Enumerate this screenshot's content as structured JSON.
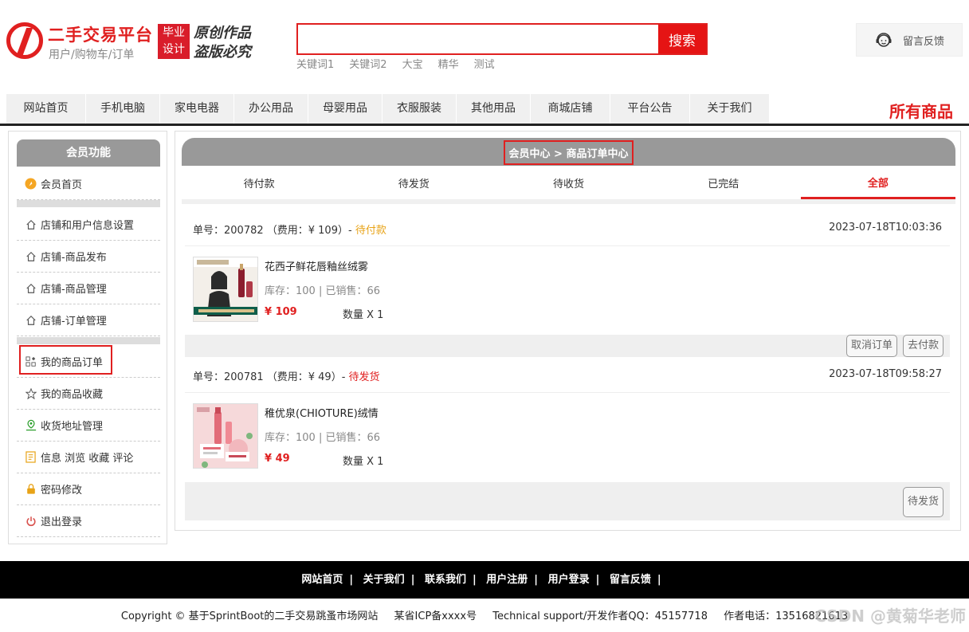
{
  "header": {
    "logo_title": "二手交易平台",
    "logo_sub": "用户/购物车/订单",
    "badge_line1": "毕业",
    "badge_line2": "设计",
    "slogan_line1": "原创作品",
    "slogan_line2": "盗版必究",
    "search_value": "",
    "search_button": "搜索",
    "keywords": [
      "关键词1",
      "关键词2",
      "大宝",
      "精华",
      "测试"
    ],
    "feedback_label": "留言反馈"
  },
  "nav": {
    "items": [
      "网站首页",
      "手机电脑",
      "家电电器",
      "办公用品",
      "母婴用品",
      "衣服服装",
      "其他用品",
      "商城店铺",
      "平台公告",
      "关于我们"
    ],
    "all_goods": "所有商品"
  },
  "sidebar": {
    "title": "会员功能",
    "items": [
      {
        "label": "会员首页",
        "icon": "orange-circle-icon"
      },
      {
        "label": "店铺和用户信息设置",
        "icon": "home-icon"
      },
      {
        "label": "店铺-商品发布",
        "icon": "home-icon"
      },
      {
        "label": "店铺-商品管理",
        "icon": "home-icon"
      },
      {
        "label": "店铺-订单管理",
        "icon": "home-icon"
      },
      {
        "label": "我的商品订单",
        "icon": "grid-icon"
      },
      {
        "label": "我的商品收藏",
        "icon": "star-icon"
      },
      {
        "label": "收货地址管理",
        "icon": "location-icon"
      },
      {
        "label": "信息 浏览 收藏 评论",
        "icon": "document-icon"
      },
      {
        "label": "密码修改",
        "icon": "lock-icon"
      },
      {
        "label": "退出登录",
        "icon": "power-icon"
      }
    ]
  },
  "main": {
    "breadcrumb": "会员中心 > 商品订单中心",
    "tabs": [
      "待付款",
      "待发货",
      "待收货",
      "已完结",
      "全部"
    ],
    "active_tab": "全部",
    "orders": [
      {
        "prefix": "单号：200782 （费用：¥ 109）- ",
        "status": "待付款",
        "status_color": "#e8a317",
        "time": "2023-07-18T10:03:36",
        "product": "花西子鲜花唇釉丝绒雾",
        "stock": "库存：100 | 已销售：66",
        "price": "¥ 109",
        "qty": "数量 X 1",
        "buttons": [
          "取消订单",
          "去付款"
        ]
      },
      {
        "prefix": "单号：200781 （费用：¥ 49）- ",
        "status": "待发货",
        "status_color": "#e02020",
        "time": "2023-07-18T09:58:27",
        "product": "稚优泉(CHIOTURE)绒情",
        "stock": "库存：100 | 已销售：66",
        "price": "¥ 49",
        "qty": "数量 X 1",
        "buttons": [
          "待发货"
        ]
      }
    ]
  },
  "footer": {
    "links": [
      "网站首页",
      "关于我们",
      "联系我们",
      "用户注册",
      "用户登录",
      "留言反馈"
    ],
    "copyright": "Copyright © 基于SprintBoot的二手交易跳蚤市场网站",
    "icp": "某省ICP备xxxx号",
    "support": "Technical support/开发作者QQ：45157718",
    "phone": "作者电话：13516821613",
    "watermark": "CSDN @黄菊华老师"
  }
}
